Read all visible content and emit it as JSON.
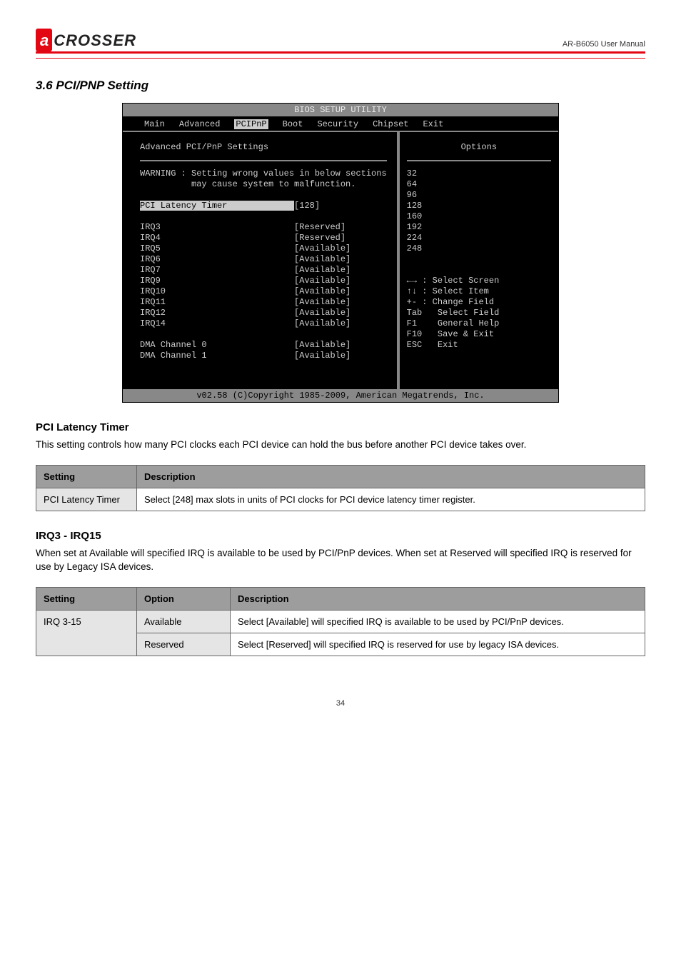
{
  "header": {
    "logo_mark": "a",
    "logo_text": "CROSSER",
    "product": "AR-B6050 User Manual"
  },
  "section_title": "3.6 PCI/PNP Setting",
  "bios": {
    "top": "BIOS SETUP UTILITY",
    "menu": [
      "Main",
      "Advanced",
      "PCIPnP",
      "Boot",
      "Security",
      "Chipset",
      "Exit"
    ],
    "menu_selected": 2,
    "left_title": "Advanced PCI/PnP Settings",
    "warn1": "WARNING : Setting wrong values in below sections",
    "warn2": "          may cause system to malfunction.",
    "selected_row": {
      "label": "PCI Latency Timer",
      "value": "[128]"
    },
    "rows": [
      {
        "label": "IRQ3",
        "value": "[Reserved]"
      },
      {
        "label": "IRQ4",
        "value": "[Reserved]"
      },
      {
        "label": "IRQ5",
        "value": "[Available]"
      },
      {
        "label": "IRQ6",
        "value": "[Available]"
      },
      {
        "label": "IRQ7",
        "value": "[Available]"
      },
      {
        "label": "IRQ9",
        "value": "[Available]"
      },
      {
        "label": "IRQ10",
        "value": "[Available]"
      },
      {
        "label": "IRQ11",
        "value": "[Available]"
      },
      {
        "label": "IRQ12",
        "value": "[Available]"
      },
      {
        "label": "IRQ14",
        "value": "[Available]"
      }
    ],
    "dma_rows": [
      {
        "label": "DMA Channel 0",
        "value": "[Available]"
      },
      {
        "label": "DMA Channel 1",
        "value": "[Available]"
      }
    ],
    "right_title": "Options",
    "options": [
      "32",
      "64",
      "96",
      "128",
      "160",
      "192",
      "224",
      "248"
    ],
    "help": [
      "←→ : Select Screen",
      "↑↓ : Select Item",
      "+- : Change Field",
      "Tab   Select Field",
      "F1    General Help",
      "F10   Save & Exit",
      "ESC   Exit"
    ],
    "footer": "v02.58 (C)Copyright 1985-2009, American Megatrends, Inc."
  },
  "pci_heading": "PCI Latency Timer",
  "pci_text": "This setting controls how many PCI clocks each PCI device can hold the bus before another PCI device takes over.",
  "table1": {
    "head": [
      "Setting",
      "Description"
    ],
    "cell1": "PCI Latency Timer",
    "cell2": "Select [248] max slots in units of PCI clocks for PCI device latency timer register."
  },
  "irq_heading": "IRQ3 - IRQ15",
  "irq_text": "When set at Available will specified IRQ is available to be used by PCI/PnP devices. When set at Reserved will specified IRQ is reserved for use by Legacy ISA devices.",
  "table2": {
    "head": [
      "Setting",
      "Option",
      "Description"
    ],
    "rows": [
      {
        "c1": "IRQ 3-15",
        "c2": "Available",
        "c3": "Select [Available] will specified IRQ is available to be used by PCI/PnP devices."
      },
      {
        "c1": "",
        "c2": "Reserved",
        "c3": "Select [Reserved] will specified IRQ is reserved for use by legacy ISA devices."
      }
    ]
  },
  "footer_text": "34"
}
